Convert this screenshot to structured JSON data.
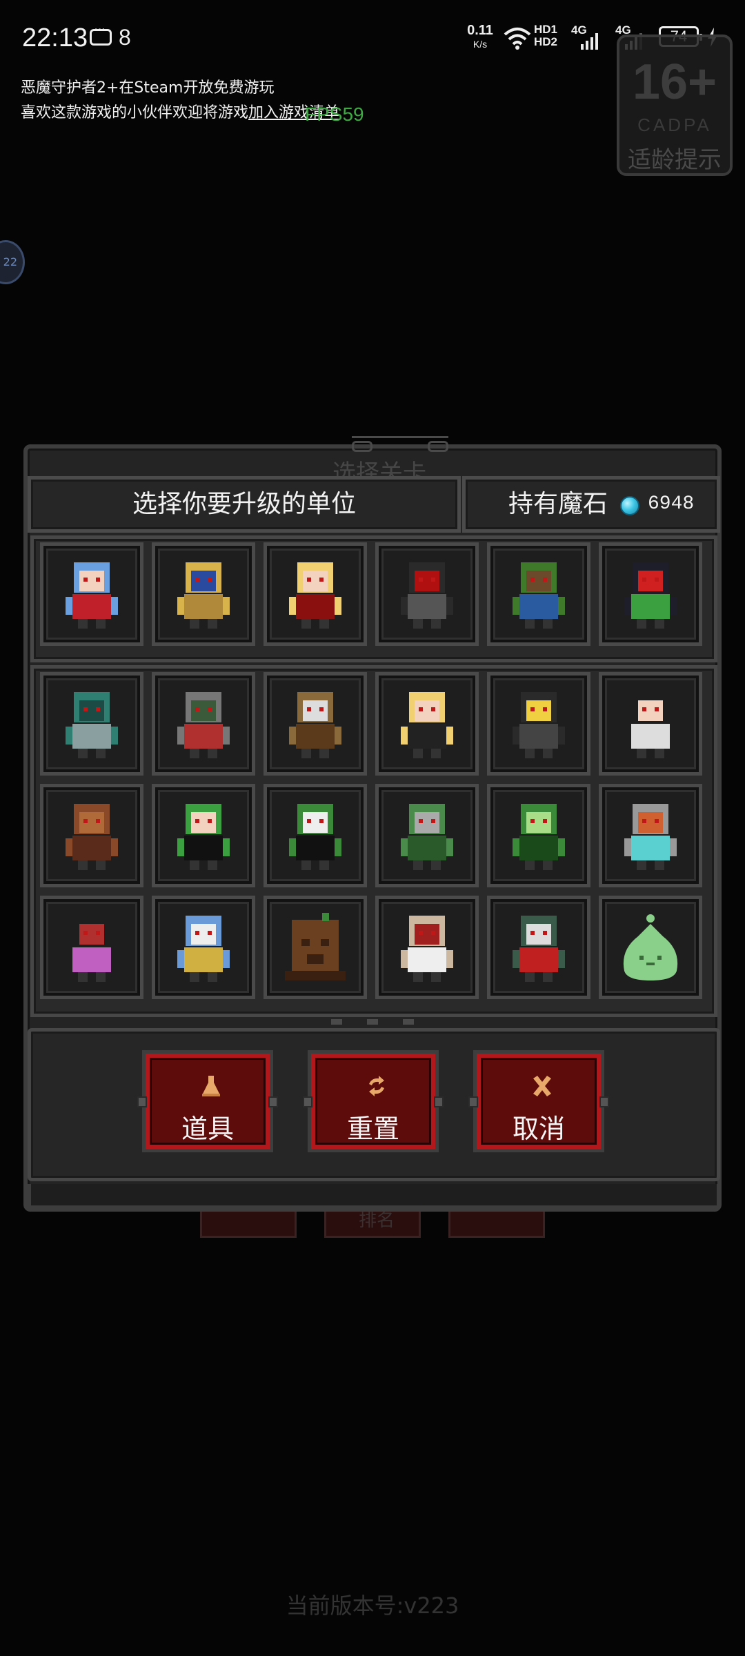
{
  "status_bar": {
    "time": "22:13",
    "notification_count": "8",
    "net_speed_value": "0.11",
    "net_speed_unit": "K/s",
    "hd1": "HD1",
    "hd2": "HD2",
    "signal1": "4G",
    "signal2": "4G",
    "battery": "74"
  },
  "promo": {
    "line1": "恶魔守护者2+在Steam开放免费游玩",
    "line2_prefix": "喜欢这款游戏的小伙伴欢迎将游戏",
    "line2_link": "加入游戏清单",
    "fps": "FPS59"
  },
  "age_rating": {
    "age": "16+",
    "org": "CADPA",
    "tip": "适龄提示"
  },
  "float_ball": "22",
  "background": {
    "title": "选择关卡",
    "button_label": "排名"
  },
  "panel": {
    "title_ghost": "选择关卡",
    "header": "选择你要升级的单位",
    "currency_label": "持有魔石",
    "currency_value": "6948",
    "units_top": [
      "blue-haired-princess",
      "golden-pharaoh",
      "blonde-vampire-girl",
      "hooded-reaper",
      "treant-elder",
      "dark-cardinal"
    ],
    "units_grid": [
      "teal-zombie",
      "feather-mask-shaman",
      "horned-minotaur",
      "blonde-fairy",
      "black-bat",
      "hooded-nun",
      "rock-golem",
      "green-haired-sorceress",
      "frankenstein",
      "green-spiked-mummy",
      "green-dragon",
      "steam-robot",
      "dark-mage",
      "blue-haired-knight",
      "tree-stump",
      "skeleton-knight",
      "goblin-warrior",
      "green-slime"
    ],
    "buttons": [
      {
        "label": "道具",
        "icon": "potion-icon"
      },
      {
        "label": "重置",
        "icon": "refresh-icon"
      },
      {
        "label": "取消",
        "icon": "close-icon"
      }
    ]
  },
  "version": "当前版本号:v223",
  "colors": {
    "panel_bg": "#242424",
    "button_red": "#b3171c",
    "fps_green": "#3fa845",
    "gem_cyan": "#3fc7e6"
  }
}
